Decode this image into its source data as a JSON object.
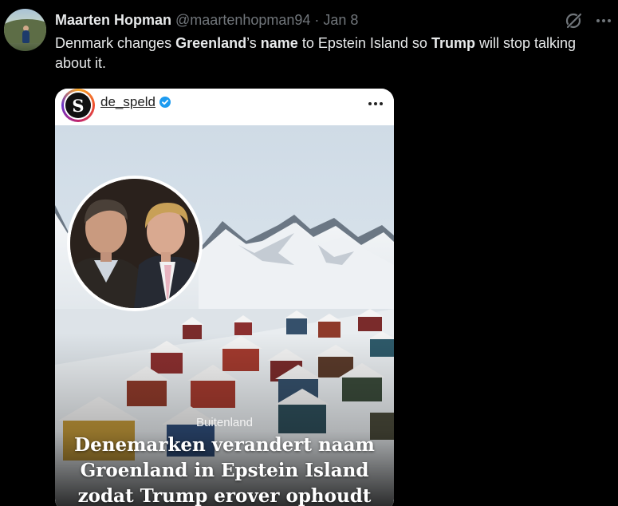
{
  "tweet": {
    "author_name": "Maarten Hopman",
    "handle": "@maartenhopman94",
    "separator": "·",
    "date": "Jan 8",
    "text_parts": [
      {
        "text": "Denmark changes ",
        "bold": false
      },
      {
        "text": "Greenland",
        "bold": true
      },
      {
        "text": "’s ",
        "bold": false
      },
      {
        "text": "name",
        "bold": true
      },
      {
        "text": " to Epstein Island so ",
        "bold": false
      },
      {
        "text": "Trump",
        "bold": true
      },
      {
        "text": " will stop talking about it.",
        "bold": false
      }
    ]
  },
  "icons": {
    "grok": "grok-icon",
    "more": "more-icon",
    "verified": "verified-badge-icon"
  },
  "card": {
    "account_logo_letter": "S",
    "account_name": "de_speld",
    "category": "Buitenland",
    "headline_lines": [
      "Denemarken verandert naam",
      "Groenland in Epstein Island",
      "zodat Trump erover ophoudt"
    ]
  },
  "colors": {
    "background": "#000000",
    "text": "#e7e9ea",
    "muted": "#71767b",
    "verified": "#1d9bf0",
    "headline_accent": "#e8622a"
  }
}
